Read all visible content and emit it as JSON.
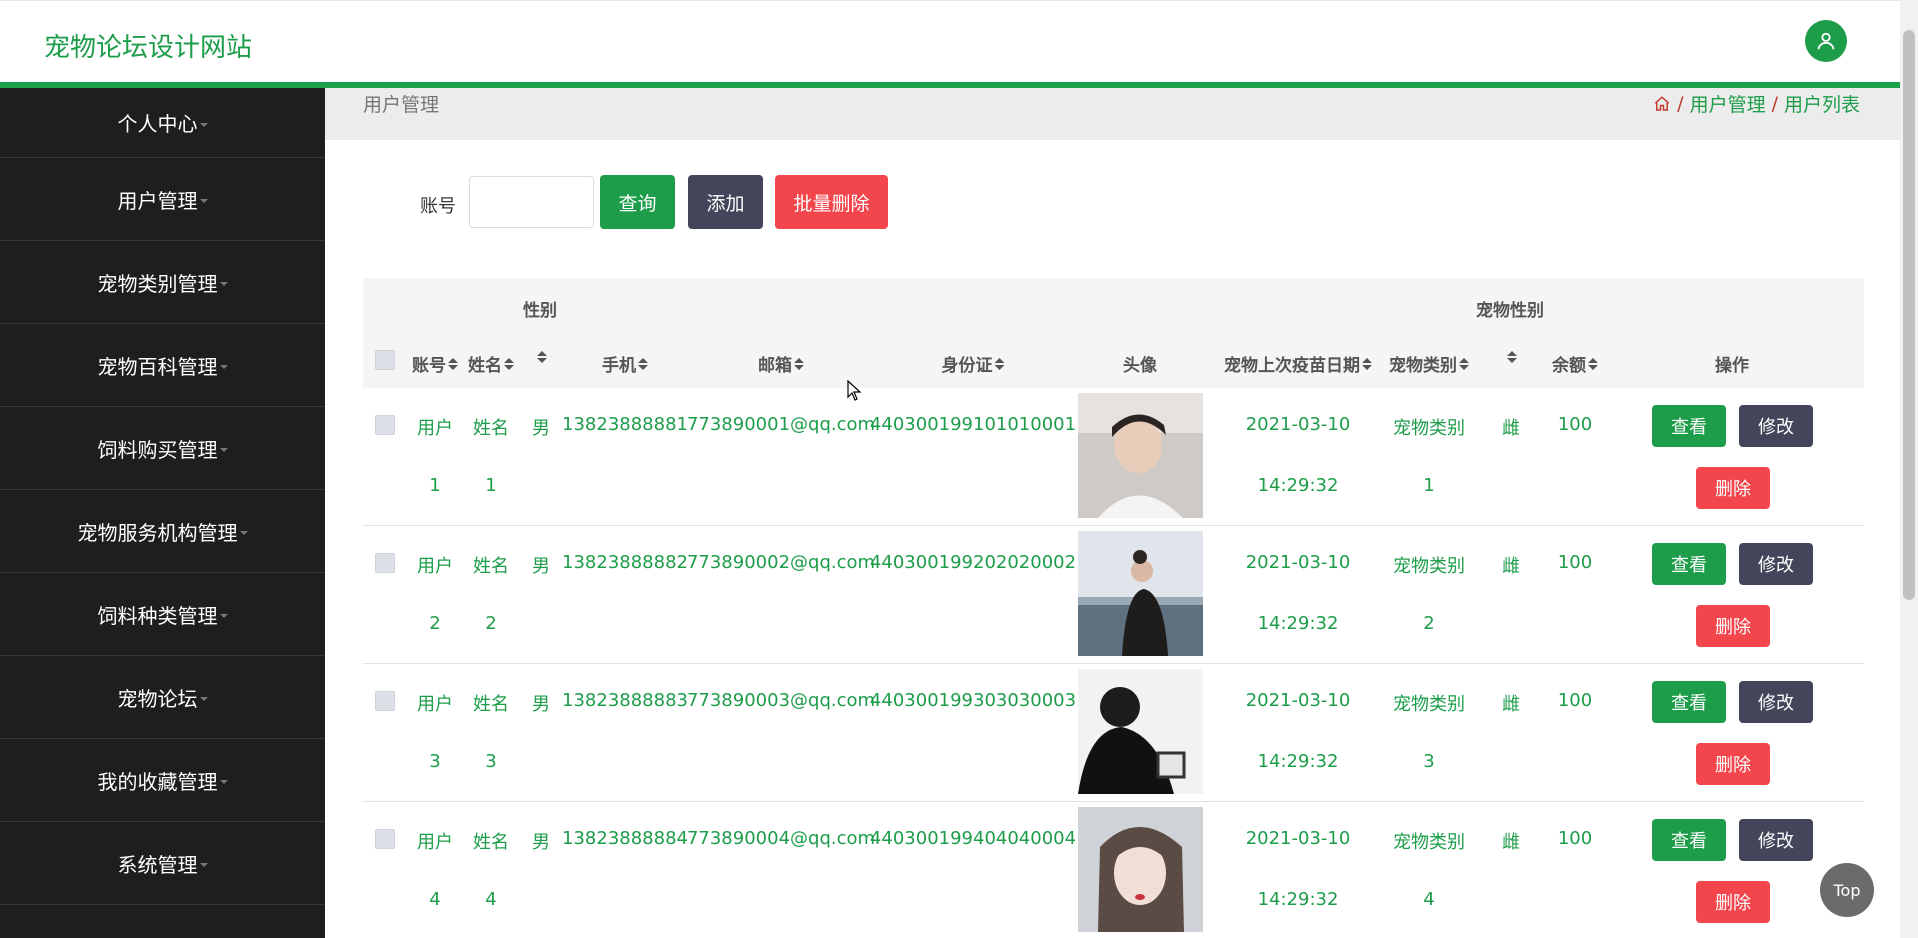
{
  "header": {
    "site_title": "宠物论坛设计网站",
    "avatar_icon": "user-icon",
    "accent_color": "#1d9d4a"
  },
  "sidebar": {
    "items": [
      {
        "label": "个人中心"
      },
      {
        "label": "用户管理"
      },
      {
        "label": "宠物类别管理"
      },
      {
        "label": "宠物百科管理"
      },
      {
        "label": "饲料购买管理"
      },
      {
        "label": "宠物服务机构管理"
      },
      {
        "label": "饲料种类管理"
      },
      {
        "label": "宠物论坛"
      },
      {
        "label": "我的收藏管理"
      },
      {
        "label": "系统管理"
      }
    ]
  },
  "page": {
    "title": "用户管理",
    "breadcrumb": [
      "用户管理",
      "用户列表"
    ]
  },
  "search": {
    "label": "账号",
    "value": "",
    "placeholder": "",
    "query_label": "查询",
    "add_label": "添加",
    "batch_delete_label": "批量删除"
  },
  "table": {
    "group_headers": {
      "gender": "性别",
      "pet_gender": "宠物性别"
    },
    "columns": {
      "account": "账号",
      "name": "姓名",
      "phone": "手机",
      "email": "邮箱",
      "idcard": "身份证",
      "avatar": "头像",
      "vaccine_date": "宠物上次疫苗日期",
      "pet_type": "宠物类别",
      "balance": "余额",
      "actions": "操作"
    },
    "rows": [
      {
        "account_a": "用户",
        "account_b": "1",
        "name_a": "姓名",
        "name_b": "1",
        "gender": "男",
        "phone": "13823888881",
        "email": "773890001@qq.com",
        "idcard": "440300199101010001",
        "date": "2021-03-10",
        "time": "14:29:32",
        "pet_a": "宠物类别",
        "pet_b": "1",
        "pet_gender": "雌",
        "balance": "100"
      },
      {
        "account_a": "用户",
        "account_b": "2",
        "name_a": "姓名",
        "name_b": "2",
        "gender": "男",
        "phone": "13823888882",
        "email": "773890002@qq.com",
        "idcard": "440300199202020002",
        "date": "2021-03-10",
        "time": "14:29:32",
        "pet_a": "宠物类别",
        "pet_b": "2",
        "pet_gender": "雌",
        "balance": "100"
      },
      {
        "account_a": "用户",
        "account_b": "3",
        "name_a": "姓名",
        "name_b": "3",
        "gender": "男",
        "phone": "13823888883",
        "email": "773890003@qq.com",
        "idcard": "440300199303030003",
        "date": "2021-03-10",
        "time": "14:29:32",
        "pet_a": "宠物类别",
        "pet_b": "3",
        "pet_gender": "雌",
        "balance": "100"
      },
      {
        "account_a": "用户",
        "account_b": "4",
        "name_a": "姓名",
        "name_b": "4",
        "gender": "男",
        "phone": "13823888884",
        "email": "773890004@qq.com",
        "idcard": "440300199404040004",
        "date": "2021-03-10",
        "time": "14:29:32",
        "pet_a": "宠物类别",
        "pet_b": "4",
        "pet_gender": "雌",
        "balance": "100"
      }
    ],
    "view_label": "查看",
    "edit_label": "修改",
    "delete_label": "删除"
  },
  "top_button": "Top"
}
